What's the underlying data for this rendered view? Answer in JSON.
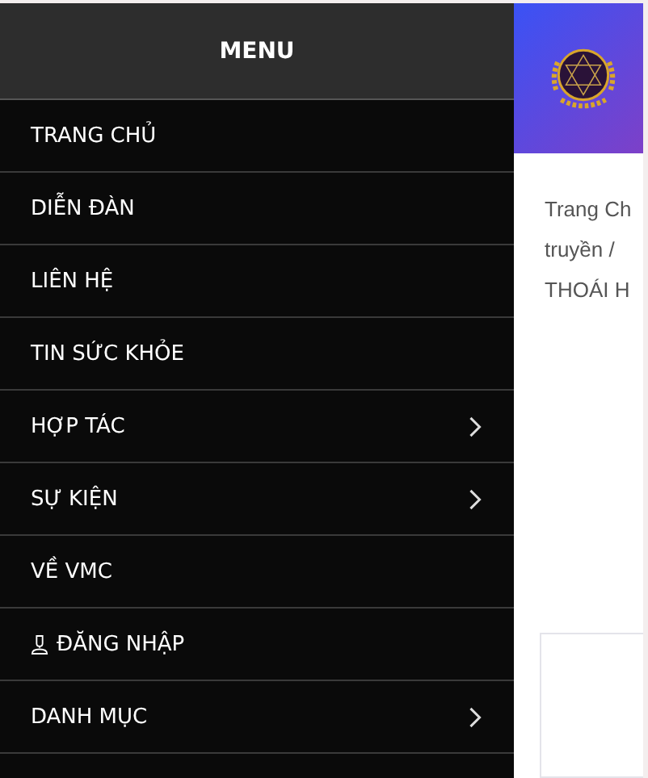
{
  "menu": {
    "title": "MENU",
    "items": [
      {
        "label": "TRANG CHỦ",
        "kind": "link"
      },
      {
        "label": "DIỄN ĐÀN",
        "kind": "link"
      },
      {
        "label": "LIÊN HỆ",
        "kind": "link"
      },
      {
        "label": "TIN SỨC KHỎE",
        "kind": "link"
      },
      {
        "label": "HỢP TÁC",
        "kind": "submenu"
      },
      {
        "label": "SỰ KIỆN",
        "kind": "submenu"
      },
      {
        "label": "VỀ VMC",
        "kind": "link"
      },
      {
        "label": "ĐĂNG NHẬP",
        "kind": "login"
      },
      {
        "label": "DANH MỤC",
        "kind": "submenu"
      }
    ]
  },
  "page": {
    "breadcrumb_lines": [
      "Trang Ch",
      "truyền /",
      "THOÁI H"
    ]
  }
}
